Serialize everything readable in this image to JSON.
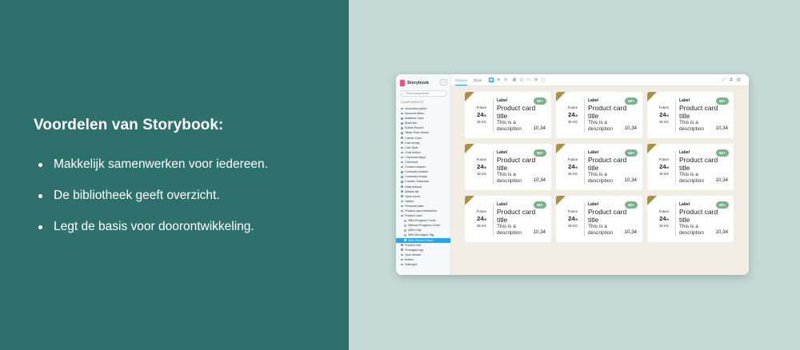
{
  "slide": {
    "headline": "Voordelen van Storybook:",
    "bullets": [
      "Makkelijk samenwerken voor iedereen.",
      "De bibliotheek geeft overzicht.",
      "Legt de basis voor doorontwikkeling."
    ]
  },
  "storybook": {
    "brand": "Storybook",
    "menu_icon": "ellipsis-icon",
    "search_placeholder": "Find components",
    "section_label": "COMPONENTS",
    "sidebar_items": [
      {
        "label": "Accordion panel"
      },
      {
        "label": "Account Menu"
      },
      {
        "label": "Address Card"
      },
      {
        "label": "Back link"
      },
      {
        "label": "Button Round"
      },
      {
        "label": "Slider Row Select"
      },
      {
        "label": "Carrier Card"
      },
      {
        "label": "Cart empty"
      },
      {
        "label": "Cart Total"
      },
      {
        "label": "Chat button"
      },
      {
        "label": "Checkout steps"
      },
      {
        "label": "Checkout"
      },
      {
        "label": "Content drawer"
      },
      {
        "label": "Contracts drawer"
      },
      {
        "label": "Contracts empty"
      },
      {
        "label": "Custom Snackbar"
      },
      {
        "label": "Data actions"
      },
      {
        "label": "Details list"
      },
      {
        "label": "Open store"
      },
      {
        "label": "Option"
      },
      {
        "label": "Personal data"
      },
      {
        "label": "Product card interactive"
      },
      {
        "label": "Product card"
      },
      {
        "label": "With Progress Circle",
        "child": true
      },
      {
        "label": "Without Progress Circle",
        "child": true
      },
      {
        "label": "With Chip",
        "child": true
      },
      {
        "label": "With Smudged Tag",
        "child": true
      },
      {
        "label": "With Status Future",
        "child": true,
        "active": true
      },
      {
        "label": "Product info"
      },
      {
        "label": "Smudged tag"
      },
      {
        "label": "Spot drawer"
      },
      {
        "label": "Button"
      },
      {
        "label": "Data grid"
      }
    ],
    "tabs": [
      {
        "label": "Canvas",
        "active": true
      },
      {
        "label": "Docs",
        "active": false
      }
    ],
    "tools_left": [
      "reset-zoom-icon",
      "zoom-in-icon",
      "zoom-out-icon",
      "grid-icon",
      "background-icon",
      "viewport-icon",
      "measure-icon",
      "outline-icon"
    ],
    "tools_right": [
      "fullscreen-icon",
      "new-tab-icon",
      "link-icon"
    ],
    "accent": "#1ea7fd",
    "canvas_bg": "#f1ede5"
  },
  "product_cards": [
    {
      "future": "Future",
      "day": "24",
      "month": "/5",
      "weight": "35 KG",
      "label": "Label",
      "title": "Product card title",
      "desc": "This is a description",
      "badge": "60+",
      "price": "10,34"
    },
    {
      "future": "Future",
      "day": "24",
      "month": "/5",
      "weight": "35 KG",
      "label": "Label",
      "title": "Product card title",
      "desc": "This is a description",
      "badge": "60+",
      "price": "10,34"
    },
    {
      "future": "Future",
      "day": "24",
      "month": "/5",
      "weight": "35 KG",
      "label": "Label",
      "title": "Product card title",
      "desc": "This is a description",
      "badge": "60+",
      "price": "10,34"
    },
    {
      "future": "Future",
      "day": "24",
      "month": "/5",
      "weight": "35 KG",
      "label": "Label",
      "title": "Product card title",
      "desc": "This is a description",
      "badge": "60+",
      "price": "10,34"
    },
    {
      "future": "Future",
      "day": "24",
      "month": "/5",
      "weight": "35 KG",
      "label": "Label",
      "title": "Product card title",
      "desc": "This is a description",
      "badge": "60+",
      "price": "10,34"
    },
    {
      "future": "Future",
      "day": "24",
      "month": "/5",
      "weight": "35 KG",
      "label": "Label",
      "title": "Product card title",
      "desc": "This is a description",
      "badge": "60+",
      "price": "10,34"
    },
    {
      "future": "Future",
      "day": "24",
      "month": "/5",
      "weight": "35 KG",
      "label": "Label",
      "title": "Product card title",
      "desc": "This is a description",
      "badge": "60+",
      "price": "10,34"
    },
    {
      "future": "Future",
      "day": "24",
      "month": "/5",
      "weight": "35 KG",
      "label": "Label",
      "title": "Product card title",
      "desc": "This is a description",
      "badge": "60+",
      "price": "10,34"
    },
    {
      "future": "Future",
      "day": "24",
      "month": "/5",
      "weight": "35 KG",
      "label": "Label",
      "title": "Product card title",
      "desc": "This is a description",
      "badge": "60+",
      "price": "10,34"
    }
  ],
  "colors": {
    "left_bg": "#2e706c",
    "right_bg": "#c4d8d5",
    "corner_gold": "#ad913c",
    "badge_green": "#7ab38a"
  }
}
